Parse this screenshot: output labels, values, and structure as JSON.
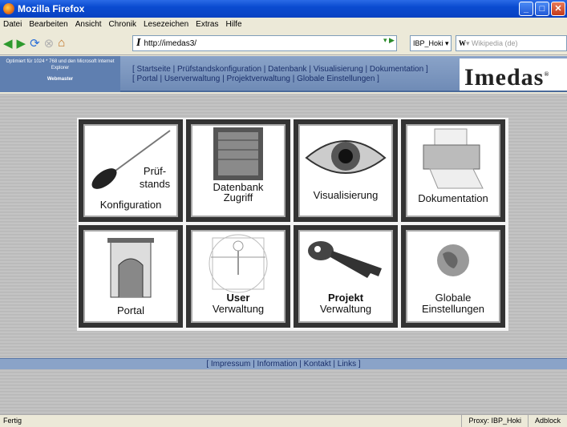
{
  "window": {
    "title": "Mozilla Firefox"
  },
  "menu": [
    "Datei",
    "Bearbeiten",
    "Ansicht",
    "Chronik",
    "Lesezeichen",
    "Extras",
    "Hilfe"
  ],
  "nav": {
    "url": "http://imedas3/",
    "profile": "IBP_Hoki",
    "search_placeholder": "Wikipedia (de)",
    "search_engine": "W"
  },
  "header": {
    "note": "Optimiert für 1024 * 768 und den Microsoft Internet Explorer",
    "webmaster": "Webmaster",
    "links_line1": "[ Startseite | Prüfstandskonfiguration | Datenbank | Visualisierung | Dokumentation ]",
    "links_line2": "[ Portal | Userverwaltung | Projektverwaltung | Globale Einstellungen ]",
    "logo_text": "Imedas",
    "logo_mark": "®"
  },
  "tiles": [
    {
      "line1": "Prüf-",
      "line2": "stands",
      "line3": "Konfiguration"
    },
    {
      "line1": "Datenbank",
      "line2": "Zugriff"
    },
    {
      "line1": "Visualisierung"
    },
    {
      "line1": "Dokumentation"
    },
    {
      "line1": "Portal"
    },
    {
      "line1": "User",
      "line2": "Verwaltung"
    },
    {
      "line1": "Projekt",
      "line2": "Verwaltung"
    },
    {
      "line1": "Globale",
      "line2": "Einstellungen"
    }
  ],
  "footer": {
    "links": "[ Impressum | Information | Kontakt | Links ]"
  },
  "status": {
    "left": "Fertig",
    "proxy": "Proxy: IBP_Hoki",
    "adblock": "Adblock"
  }
}
